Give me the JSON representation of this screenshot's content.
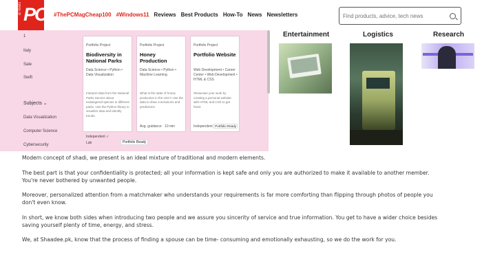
{
  "header": {
    "logo_text": "PC",
    "logo_vertical_text": "40 YEARS",
    "nav": [
      {
        "label": "#ThePCMagCheap100",
        "hot": true
      },
      {
        "label": "#Windows11",
        "hot": true
      },
      {
        "label": "Reviews",
        "hot": false
      },
      {
        "label": "Best Products",
        "hot": false
      },
      {
        "label": "How-To",
        "hot": false
      },
      {
        "label": "News",
        "hot": false
      },
      {
        "label": "Newsletters",
        "hot": false
      }
    ],
    "search_placeholder": "Find products, advice, tech news"
  },
  "overlay": {
    "side_menu": [
      "1",
      "Italy",
      "Sale",
      "Swift"
    ],
    "subjects_heading": "Subjects ⌄",
    "subjects": [
      "Data Visualization",
      "Computer Science",
      "Cybersecurity"
    ],
    "cards": [
      {
        "type": "Portfolio Project",
        "title": "Biodiversity in National Parks",
        "tags": "Data Science • Python • Data Visualization",
        "desc": "Interpret data from the National Parks Service about endangered species in different parks. Use the Python library to visualize data and identify trends.",
        "foot": "Independent ✓",
        "button": "Portfolio Ready",
        "extra": "Lab"
      },
      {
        "type": "Portfolio Project",
        "title": "Honey Production",
        "tags": "Data Science • Python • Machine Learning",
        "desc": "What is the state of honey production in the USA? Use the data to draw conclusions and predictions.",
        "foot": "Avg. guidance · 10 min",
        "button": ""
      },
      {
        "type": "Portfolio Project",
        "title": "Portfolio Website",
        "tags": "Web Development • Career Center • Web Development • HTML & CSS",
        "desc": "Showcase your work by creating a personal website with HTML and CSS to get hired.",
        "foot": "Independent ✓ 1h",
        "button": "Portfolio Ready"
      }
    ]
  },
  "categories": [
    {
      "label": "Entertainment",
      "image": "laptop-photo"
    },
    {
      "label": "Logistics",
      "image": "truck-photo"
    },
    {
      "label": "Research",
      "image": "research-photo"
    }
  ],
  "article": {
    "paragraphs": [
      "Modern concept of shadi, we present is an ideal mixture of traditional and modern elements.",
      "The best part is that your confidentiality is protected; all your information is kept safe and only you are authorized to make it available to another member. You're never bothered by unwanted people.",
      "Moreover, personalized attention from a matchmaker who understands your requirements is far more comforting than flipping through photos of people you don't even know.",
      "In short, we know both sides when introducing two people and we assure you sincerity of service and true information. You get to have a wider choice besides saving yourself plenty of time, energy, and stress.",
      "We, at Shaadee.pk, know that the process of finding a spouse can be time- consuming and emotionally exhausting, so we do the work for you."
    ]
  }
}
